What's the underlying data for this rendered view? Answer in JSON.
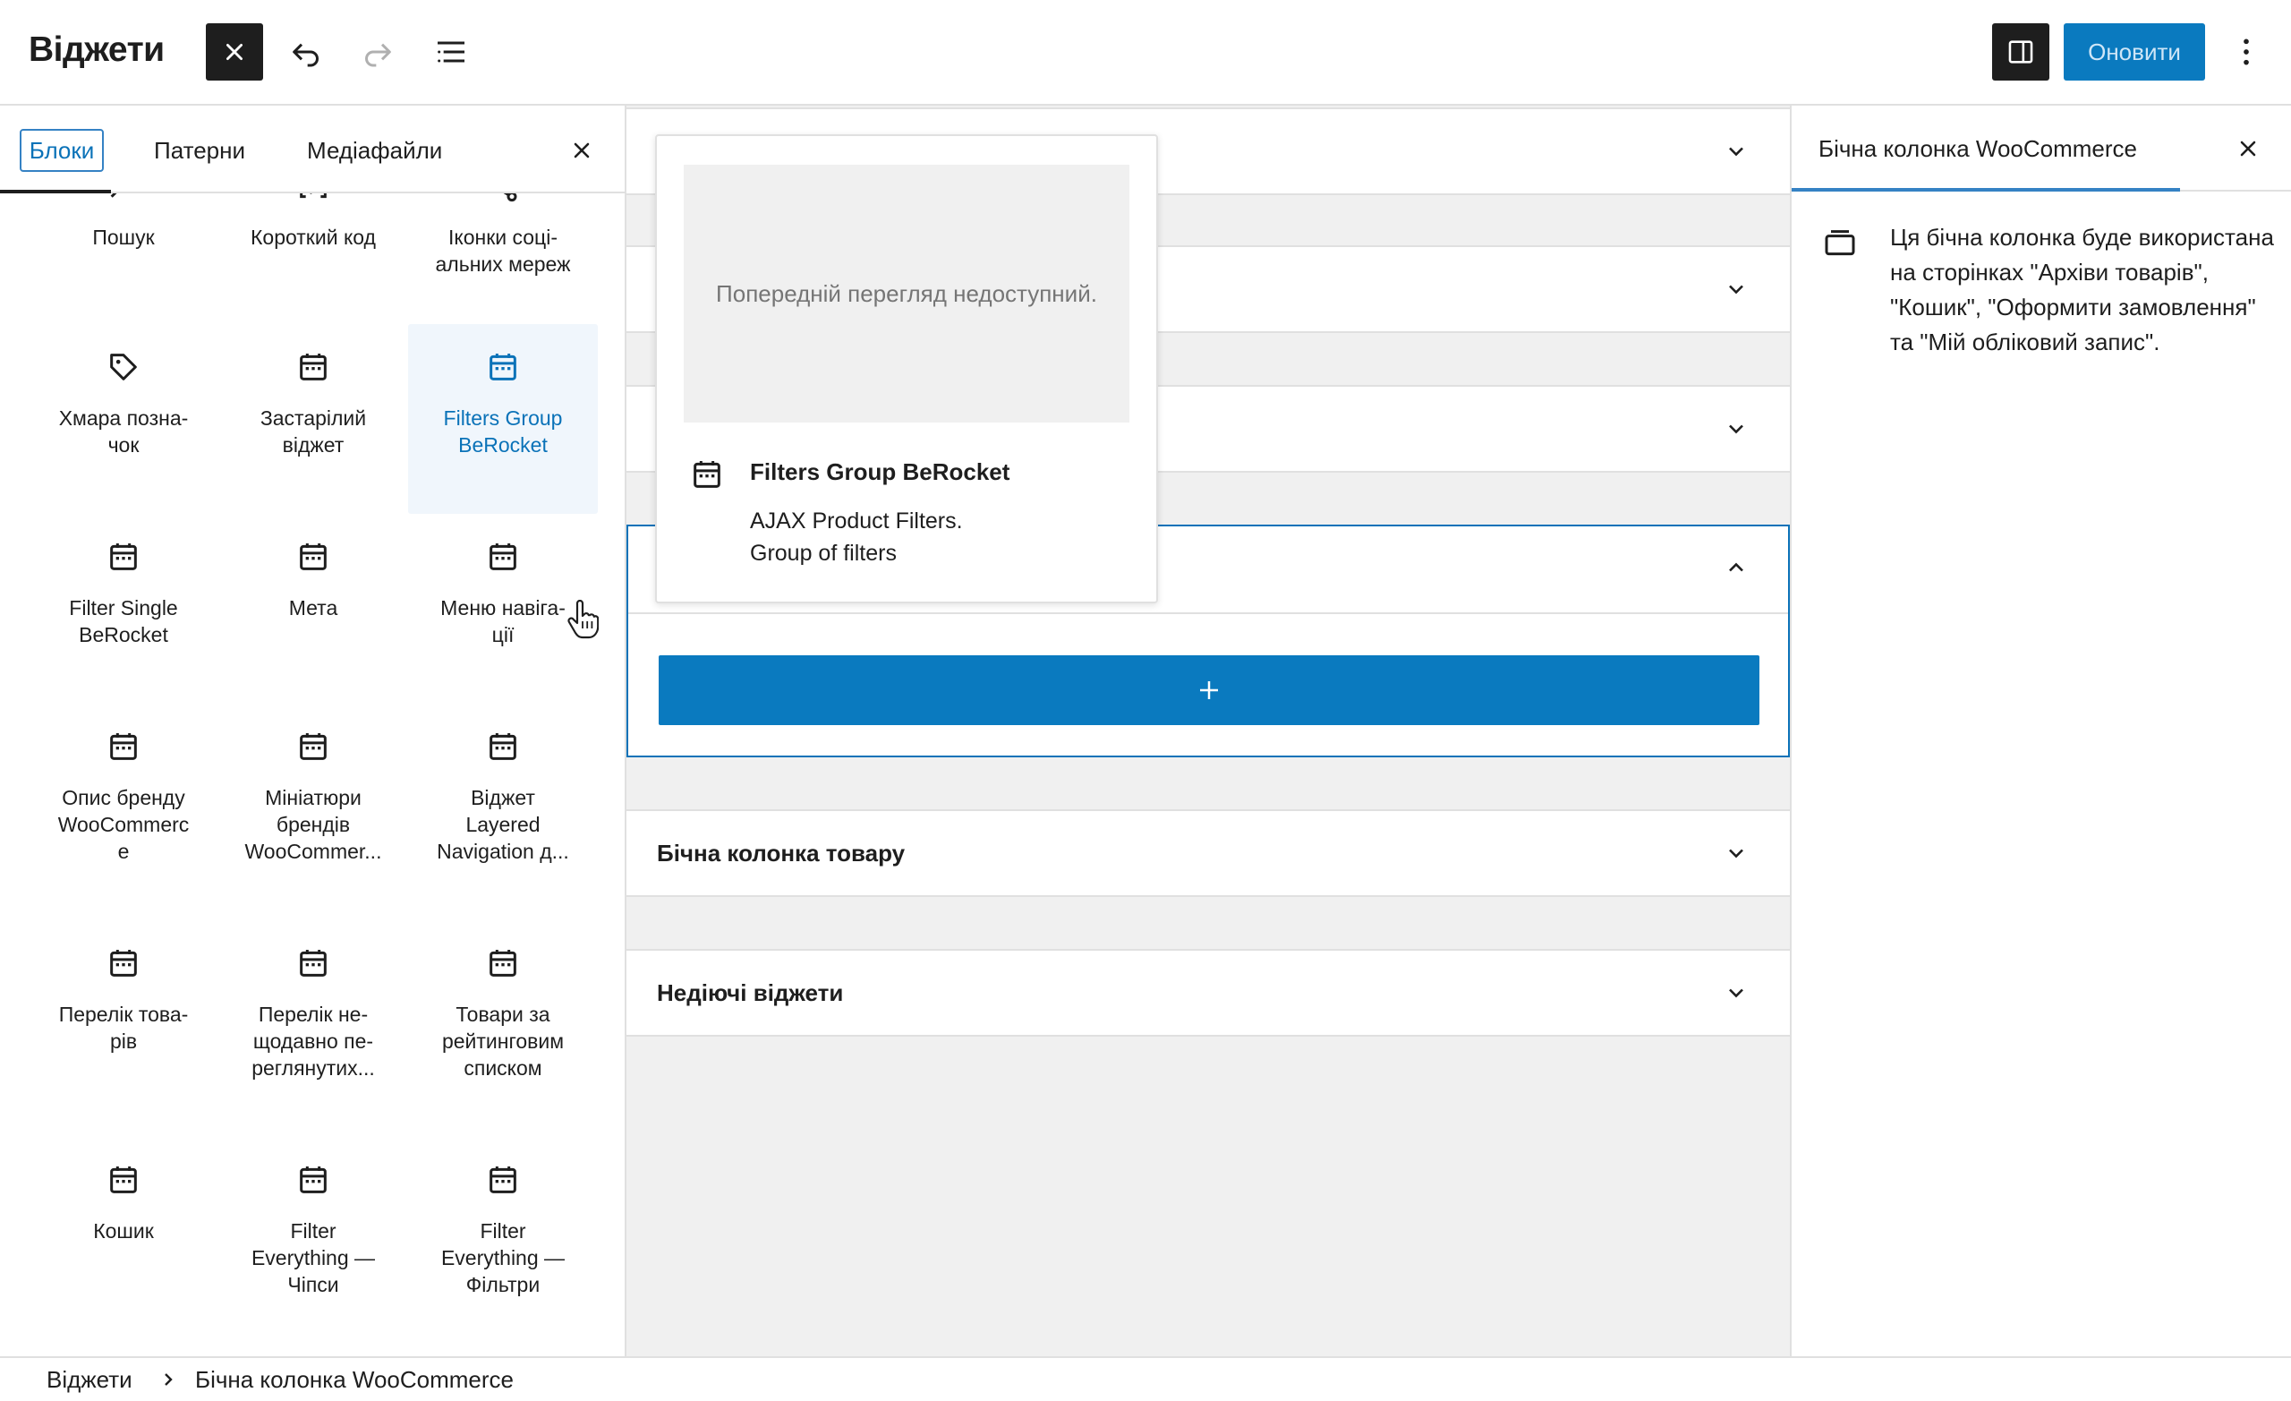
{
  "header": {
    "title": "Віджети",
    "update_label": "Оновити",
    "icons": {
      "close": "close-icon",
      "undo": "undo-icon",
      "redo": "redo-icon",
      "list_view": "list-view-icon",
      "settings": "sidebar-toggle-icon",
      "more": "more-vertical-icon"
    }
  },
  "inserter": {
    "tabs": [
      "Блоки",
      "Патерни",
      "Медіафайли"
    ],
    "active_tab": "Блоки",
    "blocks": [
      {
        "label": "Пошук",
        "icon": "search-icon"
      },
      {
        "label": "Короткий код",
        "icon": "shortcode-icon"
      },
      {
        "label": "Іконки соці-\nальних мереж",
        "icon": "share-icon"
      },
      {
        "label": "Хмара позна-\nчок",
        "icon": "tag-icon"
      },
      {
        "label": "Застарілий\nвіджет",
        "icon": "calendar-icon"
      },
      {
        "label": "Filters Group\nBeRocket",
        "icon": "calendar-icon"
      },
      {
        "label": "Filter Single\nBeRocket",
        "icon": "calendar-icon"
      },
      {
        "label": "Мета",
        "icon": "calendar-icon"
      },
      {
        "label": "Меню навіга-\nції",
        "icon": "calendar-icon"
      },
      {
        "label": "Опис бренду\nWooCommerc\nе",
        "icon": "calendar-icon"
      },
      {
        "label": "Мініатюри\nбрендів\nWooCommer...",
        "icon": "calendar-icon"
      },
      {
        "label": "Віджет\nLayered\nNavigation д...",
        "icon": "calendar-icon"
      },
      {
        "label": "Перелік това-\nрів",
        "icon": "calendar-icon"
      },
      {
        "label": "Перелік не-\nщодавно пе-\nреглянутих...",
        "icon": "calendar-icon"
      },
      {
        "label": "Товари за\nрейтинговим\nсписком",
        "icon": "calendar-icon"
      },
      {
        "label": "Кошик",
        "icon": "calendar-icon"
      },
      {
        "label": "Filter\nEverything —\nЧіпси",
        "icon": "calendar-icon"
      },
      {
        "label": "Filter\nEverything —\nФільтри",
        "icon": "calendar-icon"
      }
    ],
    "hovered_block": "Filters Group\nBeRocket"
  },
  "preview": {
    "placeholder": "Попередній перегляд недоступний.",
    "title": "Filters Group BeRocket",
    "description": "AJAX Product Filters.\nGroup of filters"
  },
  "canvas": {
    "areas": [
      {
        "title": "",
        "state": "collapsed"
      },
      {
        "title": "",
        "state": "collapsed"
      },
      {
        "title": "",
        "state": "collapsed"
      },
      {
        "title": "",
        "state": "expanded"
      },
      {
        "title": "Бічна колонка товару",
        "state": "collapsed"
      },
      {
        "title": "Недіючі віджети",
        "state": "collapsed"
      }
    ],
    "appender_icon": "plus-icon"
  },
  "sidebar": {
    "tab_label": "Бічна колонка WooCommerce",
    "description": "Ця бічна колонка буде використана на сторінках \"Архіви товарів\", \"Кошик\", \"Оформити замовлення\" та \"Мій обліковий запис\".",
    "icon": "widget-area-icon"
  },
  "footer": {
    "breadcrumb": [
      "Віджети",
      "Бічна колонка WooCommerce"
    ]
  },
  "colors": {
    "accent": "#0a7abf",
    "accent_text": "#0a72b8",
    "dark": "#1e1e1e",
    "canvas_bg": "#f0f0f0",
    "border": "#e0e0e0"
  }
}
